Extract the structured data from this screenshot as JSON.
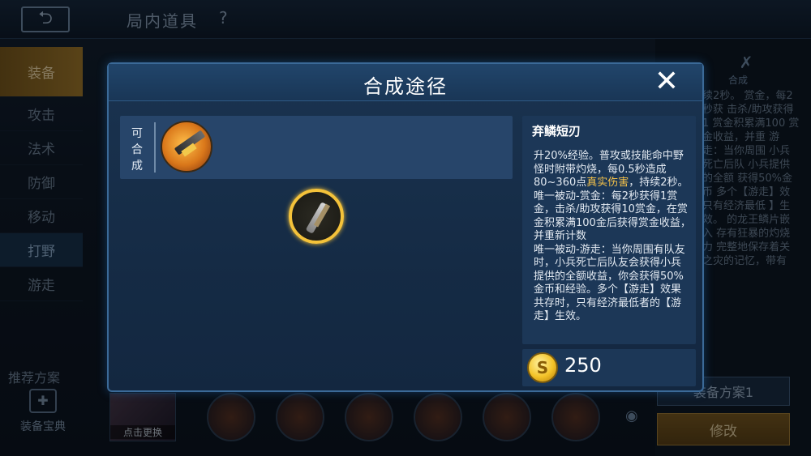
{
  "topbar": {
    "back_icon": "back-arrow-icon",
    "title": "局内道具",
    "help": "?"
  },
  "sidebar": {
    "items": [
      {
        "label": "装备"
      },
      {
        "label": "攻击"
      },
      {
        "label": "法术"
      },
      {
        "label": "防御"
      },
      {
        "label": "移动"
      },
      {
        "label": "打野"
      },
      {
        "label": "游走"
      }
    ],
    "footer": "推荐方案",
    "dict": "装备宝典"
  },
  "bottom": {
    "hero_label": "点击更换"
  },
  "right_panel": {
    "synth_label": "合成",
    "bg_text": "续2秒。 赏金，每2秒获 击杀/助攻获得1 赏金积累满100 赏金收益，并重 游走：当你周围 小兵死亡后队 小兵提供的全额 获得50%金币 多个【游走】效 只有经济最低 】生效。 的龙王鳞片嵌入 存有狂暴的灼烧力 完整地保存着关 之灾的记忆，带有",
    "plan_label": "装备方案1",
    "modify_label": "修改"
  },
  "modal": {
    "title": "合成途径",
    "close_icon": "close-icon",
    "craft_label": "可合成",
    "item": {
      "name": "弃鳞短刃",
      "desc_1": "升20%经验。普攻或技能命中野怪时附带灼烧，每0.5秒造成80~360点",
      "desc_hl": "真实伤害",
      "desc_2": "，持续2秒。",
      "desc_3": "唯一被动-赏金：每2秒获得1赏金，击杀/助攻获得10赏金，在赏金积累满100金后获得赏金收益，并重新计数",
      "desc_4": "唯一被动-游走：当你周围有队友时，小兵死亡后队友会获得小兵提供的全额收益，你会获得50%金币和经验。多个【游走】效果共存时，只有经济最低者的【游走】生效。",
      "price": "250"
    }
  },
  "colors": {
    "accent_gold": "#f4c23a",
    "highlight": "#f5c24a",
    "modal_border": "#3b6a98"
  }
}
